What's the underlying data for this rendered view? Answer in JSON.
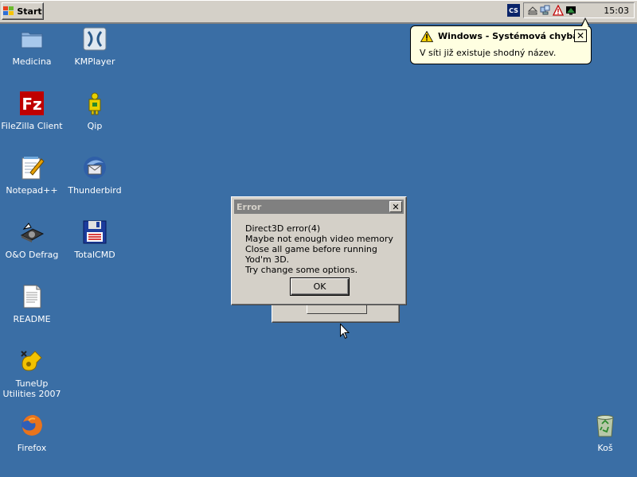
{
  "taskbar": {
    "start_label": "Start",
    "lang": "CS",
    "clock": "15:03",
    "tray_icons": [
      "eject-icon",
      "network-icon",
      "warning-icon",
      "monitor-icon"
    ]
  },
  "balloon": {
    "title": "Windows - Systémová chyba",
    "text": "V síti již existuje shodný název.",
    "close": "✕"
  },
  "desktop": {
    "icons": [
      {
        "label": "Medicina",
        "icon": "folder-icon"
      },
      {
        "label": "KMPlayer",
        "icon": "kmplayer-icon"
      },
      {
        "label": "FileZilla Client",
        "icon": "filezilla-icon"
      },
      {
        "label": "Qip",
        "icon": "qip-icon"
      },
      {
        "label": "Notepad++",
        "icon": "notepad-icon"
      },
      {
        "label": "Thunderbird",
        "icon": "thunderbird-icon"
      },
      {
        "label": "O&O Defrag",
        "icon": "defrag-icon"
      },
      {
        "label": "TotalCMD",
        "icon": "totalcmd-icon"
      },
      {
        "label": "README",
        "icon": "document-icon"
      },
      {
        "label": "TuneUp Utilities 2007",
        "icon": "tuneup-icon"
      },
      {
        "label": "Firefox",
        "icon": "firefox-icon"
      },
      {
        "label": "Koš",
        "icon": "recycle-bin-icon"
      }
    ]
  },
  "error_dialog": {
    "title": "Error",
    "close": "✕",
    "lines": [
      "Direct3D error(4)",
      "Maybe not enough video memory",
      "Close all game before running Yod'm 3D.",
      "Try change some options."
    ],
    "ok_label": "OK"
  },
  "colors": {
    "desktop": "#3a6ea5",
    "taskbar": "#d4d0c8",
    "balloon_bg": "#ffffe1",
    "inactive_title": "#808080"
  }
}
